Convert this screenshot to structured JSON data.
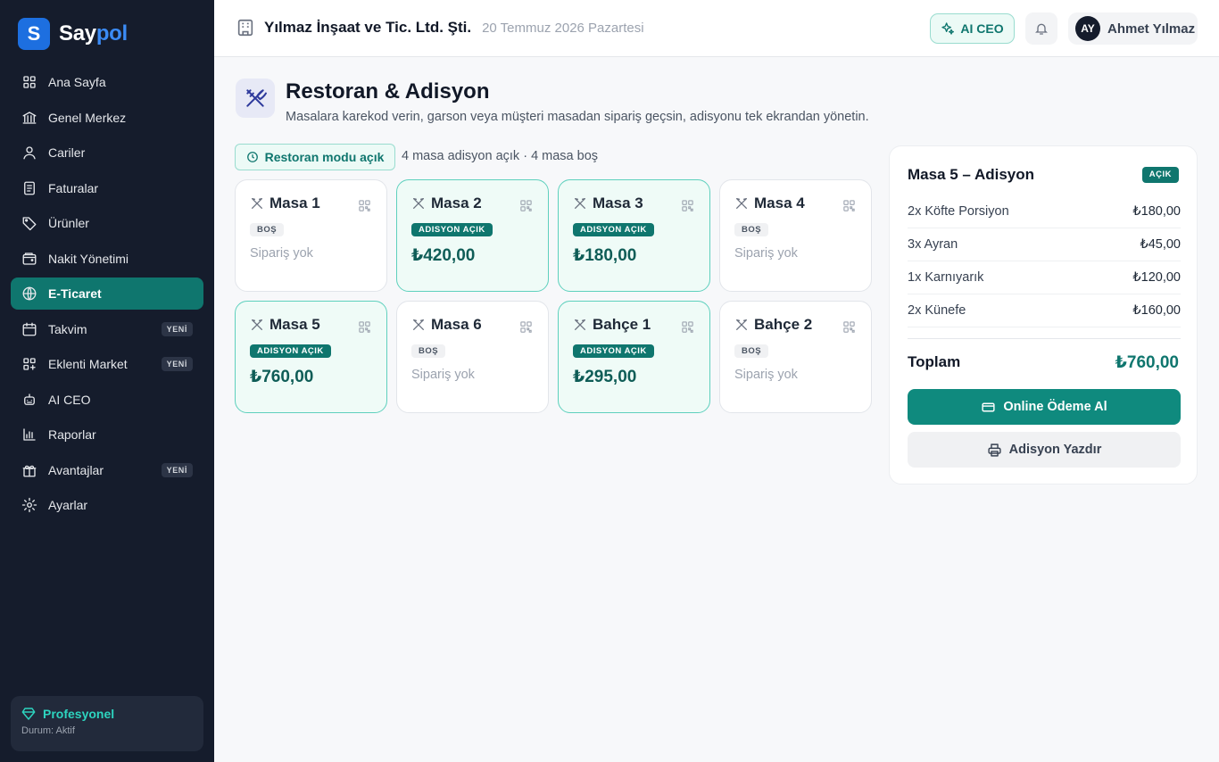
{
  "brand": {
    "badge": "S",
    "name_part1": "Say",
    "name_part2": "pol"
  },
  "sidebar": {
    "items": [
      {
        "label": "Ana Sayfa",
        "icon": "grid-icon"
      },
      {
        "label": "Genel Merkez",
        "icon": "bank-icon"
      },
      {
        "label": "Cariler",
        "icon": "user-icon"
      },
      {
        "label": "Faturalar",
        "icon": "document-icon"
      },
      {
        "label": "Ürünler",
        "icon": "tag-icon"
      },
      {
        "label": "Nakit Yönetimi",
        "icon": "wallet-icon"
      },
      {
        "label": "E-Ticaret",
        "icon": "globe-icon",
        "active": true
      },
      {
        "label": "Takvim",
        "icon": "calendar-icon",
        "badge": "YENİ"
      },
      {
        "label": "Eklenti Market",
        "icon": "apps-icon",
        "badge": "YENİ"
      },
      {
        "label": "AI CEO",
        "icon": "robot-icon"
      },
      {
        "label": "Raporlar",
        "icon": "bar-chart-icon"
      },
      {
        "label": "Avantajlar",
        "icon": "gift-icon",
        "badge": "YENİ"
      },
      {
        "label": "Ayarlar",
        "icon": "gear-icon"
      }
    ],
    "plan": {
      "title": "Profesyonel",
      "status": "Durum: Aktif"
    }
  },
  "header": {
    "company": "Yılmaz İnşaat ve Tic. Ltd. Şti.",
    "date": "20 Temmuz 2026 Pazartesi",
    "ai_label": "AI CEO",
    "user_initials": "AY",
    "user_name": "Ahmet Yılmaz"
  },
  "page": {
    "title": "Restoran & Adisyon",
    "subtitle": "Masalara karekod verin, garson veya müşteri masadan sipariş geçsin, adisyonu tek ekrandan yönetin.",
    "mode_label": "Restoran modu açık",
    "counts": "4 masa adisyon açık · 4 masa boş"
  },
  "tables": [
    {
      "name": "Masa 1",
      "status": "BOŞ",
      "open": false,
      "info": "Sipariş yok"
    },
    {
      "name": "Masa 2",
      "status": "ADISYON AÇIK",
      "open": true,
      "info": "₺420,00"
    },
    {
      "name": "Masa 3",
      "status": "ADISYON AÇIK",
      "open": true,
      "info": "₺180,00"
    },
    {
      "name": "Masa 4",
      "status": "BOŞ",
      "open": false,
      "info": "Sipariş yok"
    },
    {
      "name": "Masa 5",
      "status": "ADISYON AÇIK",
      "open": true,
      "info": "₺760,00"
    },
    {
      "name": "Masa 6",
      "status": "BOŞ",
      "open": false,
      "info": "Sipariş yok"
    },
    {
      "name": "Bahçe 1",
      "status": "ADISYON AÇIK",
      "open": true,
      "info": "₺295,00"
    },
    {
      "name": "Bahçe 2",
      "status": "BOŞ",
      "open": false,
      "info": "Sipariş yok"
    }
  ],
  "receipt": {
    "title": "Masa 5 – Adisyon",
    "badge": "AÇIK",
    "items": [
      {
        "name": "2x Köfte Porsiyon",
        "price": "₺180,00"
      },
      {
        "name": "3x Ayran",
        "price": "₺45,00"
      },
      {
        "name": "1x Karnıyarık",
        "price": "₺120,00"
      },
      {
        "name": "2x Künefe",
        "price": "₺160,00"
      }
    ],
    "total_label": "Toplam",
    "total_value": "₺760,00",
    "pay_label": "Online Ödeme Al",
    "print_label": "Adisyon Yazdır"
  },
  "colors": {
    "accent": "#0f766e",
    "sidebar_bg": "#151c2c",
    "brand_blue": "#1d6fe0"
  }
}
